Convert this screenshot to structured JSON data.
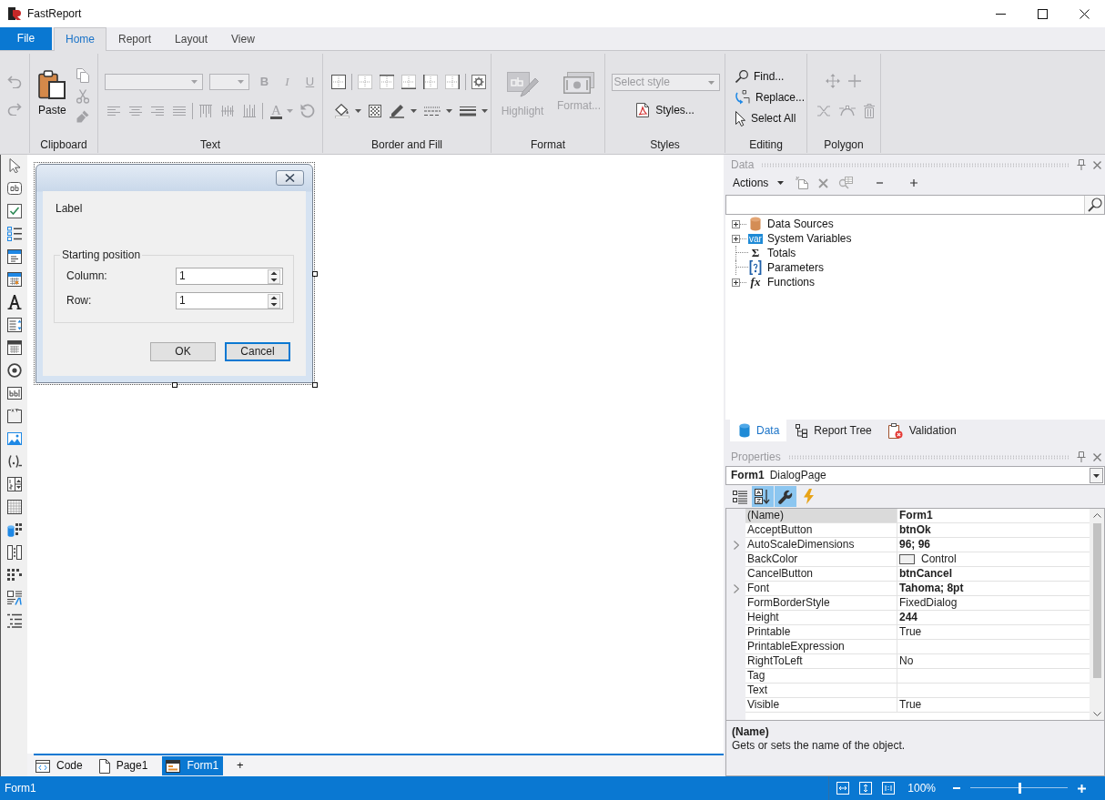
{
  "window": {
    "title": "FastReport"
  },
  "ribbon": {
    "tabs": [
      {
        "label": "File",
        "kind": "file",
        "selected": false
      },
      {
        "label": "Home",
        "kind": "tab",
        "selected": true
      },
      {
        "label": "Report",
        "kind": "tab",
        "selected": false
      },
      {
        "label": "Layout",
        "kind": "tab",
        "selected": false
      },
      {
        "label": "View",
        "kind": "tab",
        "selected": false
      }
    ],
    "groups": [
      {
        "kind": "history",
        "buttons": [
          {
            "kind": "undo",
            "disabled": true
          },
          {
            "kind": "redo",
            "disabled": true
          }
        ]
      },
      {
        "kind": "clipboard",
        "label": "Clipboard",
        "paste": {
          "label": "Paste",
          "disabled": false
        },
        "buttons": [
          {
            "kind": "copy",
            "disabled": true
          },
          {
            "kind": "cut",
            "disabled": true
          },
          {
            "kind": "format_painter",
            "disabled": true
          }
        ]
      },
      {
        "kind": "text",
        "label": "Text",
        "disabled": true,
        "styles": [
          {
            "kind": "bold",
            "label": "B"
          },
          {
            "kind": "italic",
            "label": "I"
          },
          {
            "kind": "underline",
            "label": "U"
          }
        ],
        "font_color": {
          "label": "A"
        }
      },
      {
        "kind": "border_fill",
        "label": "Border and Fill"
      },
      {
        "kind": "format",
        "label": "Format",
        "buttons": [
          {
            "kind": "highlight",
            "label": "Highlight",
            "disabled": true
          },
          {
            "kind": "format",
            "label": "Format...",
            "disabled": true
          }
        ]
      },
      {
        "kind": "styles",
        "label": "Styles",
        "style_field": {
          "placeholder": "Select style"
        },
        "button": {
          "label": "Styles..."
        }
      },
      {
        "kind": "editing",
        "label": "Editing",
        "buttons": [
          {
            "kind": "find",
            "label": "Find..."
          },
          {
            "kind": "replace",
            "label": "Replace..."
          },
          {
            "kind": "select_all",
            "label": "Select All"
          }
        ]
      },
      {
        "kind": "polygon",
        "label": "Polygon",
        "disabled": true
      }
    ]
  },
  "designer": {
    "form": {
      "selected": true,
      "label": "Label",
      "group": {
        "title": "Starting position",
        "fields": [
          {
            "label": "Column:",
            "value": "1"
          },
          {
            "label": "Row:",
            "value": "1"
          }
        ]
      },
      "buttons": [
        {
          "label": "OK",
          "focused": false
        },
        {
          "label": "Cancel",
          "focused": true
        }
      ]
    },
    "tabs": [
      {
        "kind": "code",
        "label": "Code",
        "selected": false
      },
      {
        "kind": "page",
        "label": "Page1",
        "selected": false
      },
      {
        "kind": "form",
        "label": "Form1",
        "selected": true
      }
    ],
    "add_tab": "+"
  },
  "data_panel": {
    "title": "Data",
    "actions": "Actions",
    "tree": [
      {
        "kind": "data_sources",
        "label": "Data Sources",
        "expandable": true
      },
      {
        "kind": "variables",
        "label": "System Variables",
        "expandable": true,
        "badge": "var"
      },
      {
        "kind": "totals",
        "label": "Totals",
        "expandable": false,
        "glyph": "Σ"
      },
      {
        "kind": "parameters",
        "label": "Parameters",
        "expandable": false
      },
      {
        "kind": "functions",
        "label": "Functions",
        "expandable": true,
        "glyph": "fx"
      }
    ],
    "tabs": [
      {
        "kind": "data",
        "label": "Data",
        "selected": true
      },
      {
        "kind": "report_tree",
        "label": "Report Tree",
        "selected": false
      },
      {
        "kind": "validation",
        "label": "Validation",
        "selected": false
      }
    ]
  },
  "properties_panel": {
    "title": "Properties",
    "object": {
      "name": "Form1",
      "type": "DialogPage"
    },
    "toolbar": [
      {
        "kind": "categorized",
        "selected": false
      },
      {
        "kind": "alphabetical",
        "selected": true
      },
      {
        "kind": "properties",
        "selected": true
      },
      {
        "kind": "events",
        "selected": false
      }
    ],
    "rows": [
      {
        "name": "(Name)",
        "value": "Form1",
        "modified": true,
        "expandable": false,
        "selected": true
      },
      {
        "name": "AcceptButton",
        "value": "btnOk",
        "modified": true,
        "expandable": false,
        "selected": false
      },
      {
        "name": "AutoScaleDimensions",
        "value": "96; 96",
        "modified": true,
        "expandable": true,
        "selected": false
      },
      {
        "name": "BackColor",
        "value": "Control",
        "modified": false,
        "expandable": false,
        "selected": false,
        "color": "#f0f0f0"
      },
      {
        "name": "CancelButton",
        "value": "btnCancel",
        "modified": true,
        "expandable": false,
        "selected": false
      },
      {
        "name": "Font",
        "value": "Tahoma; 8pt",
        "modified": true,
        "expandable": true,
        "selected": false
      },
      {
        "name": "FormBorderStyle",
        "value": "FixedDialog",
        "modified": false,
        "expandable": false,
        "selected": false
      },
      {
        "name": "Height",
        "value": "244",
        "modified": true,
        "expandable": false,
        "selected": false
      },
      {
        "name": "Printable",
        "value": "True",
        "modified": false,
        "expandable": false,
        "selected": false
      },
      {
        "name": "PrintableExpression",
        "expandable": false,
        "selected": false
      },
      {
        "name": "RightToLeft",
        "value": "No",
        "modified": false,
        "expandable": false,
        "selected": false
      },
      {
        "name": "Tag",
        "expandable": false,
        "selected": false
      },
      {
        "name": "Text",
        "expandable": false,
        "selected": false
      },
      {
        "name": "Visible",
        "value": "True",
        "modified": false,
        "expandable": false,
        "selected": false
      }
    ],
    "description": {
      "title": "(Name)",
      "text": "Gets or sets the name of the object."
    }
  },
  "status_bar": {
    "text": "Form1",
    "zoom": "100%",
    "zoom_slider": {
      "level": 0.5
    }
  }
}
